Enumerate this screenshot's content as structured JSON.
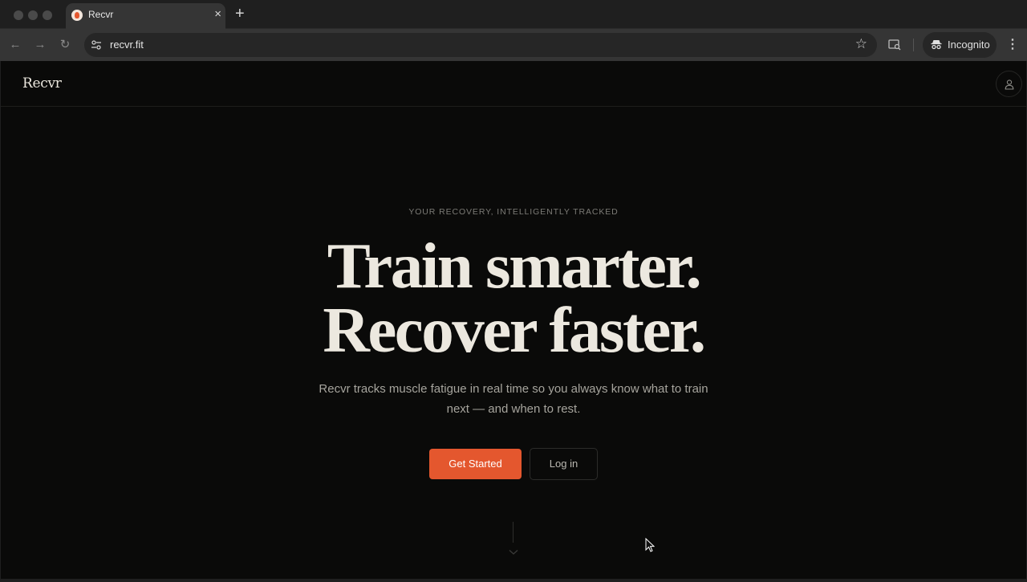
{
  "browser": {
    "tab_title": "Recvr",
    "tab_close": "×",
    "new_tab": "+",
    "url": "recvr.fit",
    "profile_label": "Incognito",
    "back_glyph": "←",
    "forward_glyph": "→",
    "reload_glyph": "↻",
    "star_glyph": "☆",
    "menu_glyph": "⋮"
  },
  "site": {
    "logo": "Recvr",
    "accent_color": "#e4572e",
    "background_color": "#0a0a09"
  },
  "hero": {
    "eyebrow": "YOUR RECOVERY, INTELLIGENTLY TRACKED",
    "headline_line1": "Train smarter.",
    "headline_line2": "Recover faster.",
    "subtext": "Recvr tracks muscle fatigue in real time so you always know what to train next — and when to rest.",
    "primary_cta": "Get Started",
    "secondary_cta": "Log in"
  },
  "icons": [
    "tune-icon",
    "star-icon",
    "reading-mode-icon",
    "incognito-icon",
    "user-icon",
    "chevron-down-icon"
  ]
}
